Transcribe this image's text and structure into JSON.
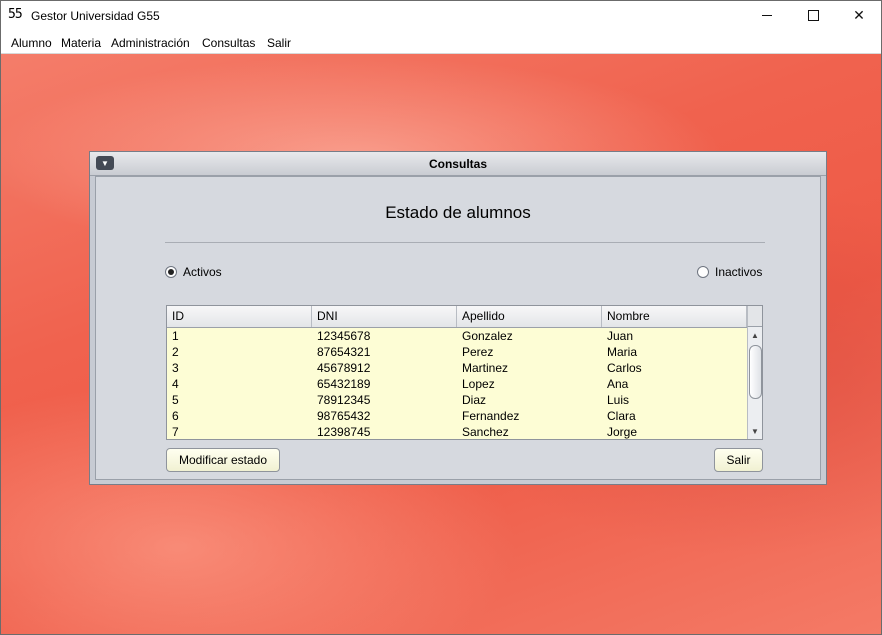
{
  "window": {
    "app_icon": "55",
    "title": "Gestor Universidad G55",
    "controls": {
      "minimize": "minimize-icon",
      "maximize": "maximize-icon",
      "close": "✕"
    }
  },
  "menubar": {
    "items": [
      "Alumno",
      "Materia",
      "Administración",
      "Consultas",
      "Salir"
    ]
  },
  "internal_frame": {
    "title": "Consultas",
    "menu_icon": "▼",
    "heading": "Estado de alumnos",
    "radios": {
      "activos": {
        "label": "Activos",
        "selected": true
      },
      "inactivos": {
        "label": "Inactivos",
        "selected": false
      }
    },
    "table": {
      "columns": [
        "ID",
        "DNI",
        "Apellido",
        "Nombre"
      ],
      "rows": [
        [
          "1",
          "12345678",
          "Gonzalez",
          "Juan"
        ],
        [
          "2",
          "87654321",
          "Perez",
          "Maria"
        ],
        [
          "3",
          "45678912",
          "Martinez",
          "Carlos"
        ],
        [
          "4",
          "65432189",
          "Lopez",
          "Ana"
        ],
        [
          "5",
          "78912345",
          "Diaz",
          "Luis"
        ],
        [
          "6",
          "98765432",
          "Fernandez",
          "Clara"
        ],
        [
          "7",
          "12398745",
          "Sanchez",
          "Jorge"
        ]
      ]
    },
    "buttons": {
      "modificar": "Modificar estado",
      "salir": "Salir"
    }
  },
  "colors": {
    "desktop": "#ef5e4a",
    "table_background": "#fdfdd5",
    "button_background": "#f6f6dc",
    "frame_background": "#d6d9df"
  }
}
